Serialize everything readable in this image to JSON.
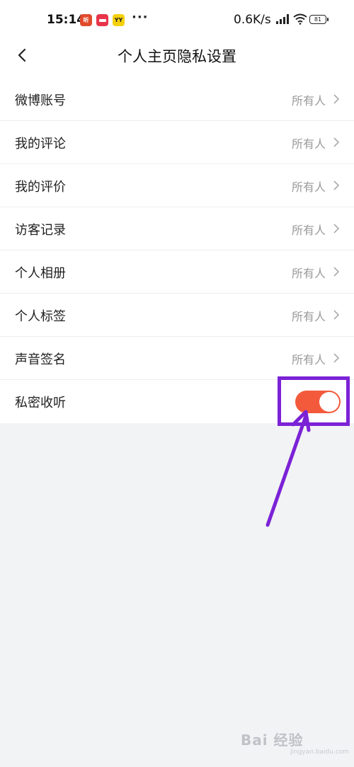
{
  "status": {
    "time": "15:14",
    "dots": "···",
    "speed": "0.6K/s",
    "battery": "81",
    "apps": [
      {
        "name": "app-icon-1",
        "text": "听",
        "color": "#e04a2b"
      },
      {
        "name": "app-icon-2",
        "text": "",
        "color": "#e8344a"
      },
      {
        "name": "app-icon-3",
        "text": "YY",
        "color": "#f5d10e"
      }
    ]
  },
  "nav": {
    "title": "个人主页隐私设置"
  },
  "settings": {
    "rows": [
      {
        "label": "微博账号",
        "value": "所有人"
      },
      {
        "label": "我的评论",
        "value": "所有人"
      },
      {
        "label": "我的评价",
        "value": "所有人"
      },
      {
        "label": "访客记录",
        "value": "所有人"
      },
      {
        "label": "个人相册",
        "value": "所有人"
      },
      {
        "label": "个人标签",
        "value": "所有人"
      },
      {
        "label": "声音签名",
        "value": "所有人"
      }
    ],
    "toggle_row": {
      "label": "私密收听",
      "on": true
    }
  },
  "watermark": {
    "text": "Bai 经验",
    "sub": "jingyan.baidu.com"
  },
  "colors": {
    "toggle_on": "#f35a3c",
    "annotation": "#7b22d6"
  }
}
